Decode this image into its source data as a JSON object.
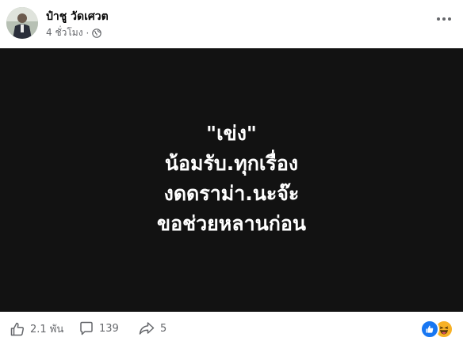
{
  "post": {
    "author": "ป๋าชู วัดเศวต",
    "time": "4 ชั่วโมง",
    "separator": "·"
  },
  "media": {
    "lines": [
      "\"เข่ง\"",
      "น้อมรับ.ทุกเรื่อง",
      "งดดราม่า.นะจ๊ะ",
      "ขอช่วยหลานก่อน"
    ],
    "background": "#121212"
  },
  "footer": {
    "likes": "2.1 พัน",
    "comments": "139",
    "shares": "5"
  },
  "icons": {
    "more": "more-dots-icon",
    "audience": "globe-icon",
    "like": "thumbs-up-icon",
    "comment": "comment-icon",
    "share": "share-icon",
    "reaction_like": "like-reaction-icon",
    "reaction_haha": "haha-reaction-icon"
  },
  "colors": {
    "accent": "#1877f2",
    "secondary_text": "#65676b",
    "haha": "#f7b125"
  }
}
